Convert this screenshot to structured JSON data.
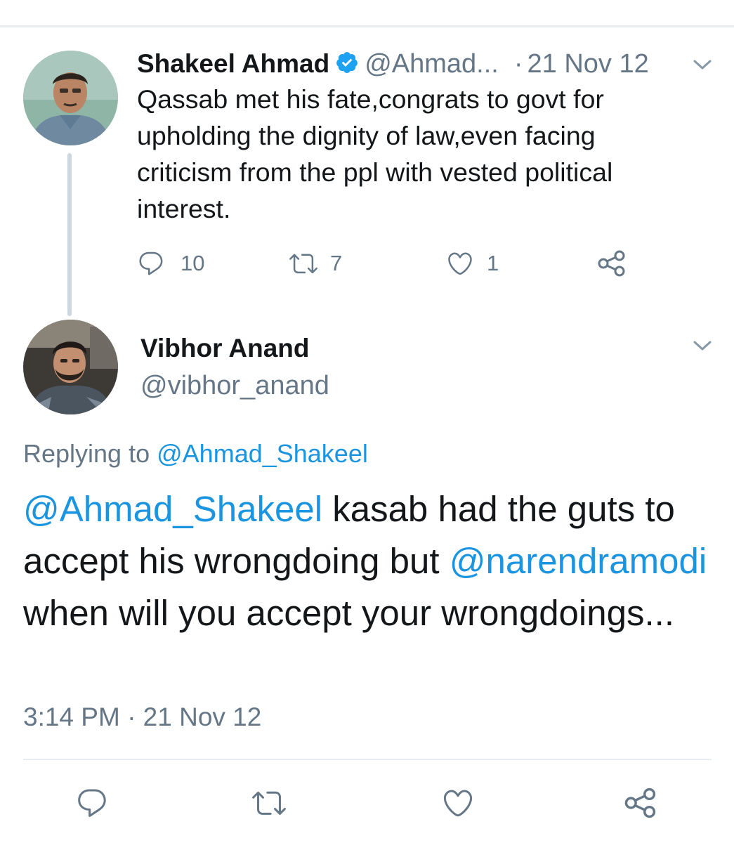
{
  "parent_tweet": {
    "author_name": "Shakeel Ahmad",
    "verified_icon": "verified-badge-icon",
    "handle": "@Ahmad...",
    "separator": "·",
    "date": "21 Nov 12",
    "text": "Qassab met his fate,congrats to govt for upholding the dignity of law,even facing criticism from the ppl with vested political interest.",
    "actions": {
      "reply_count": "10",
      "retweet_count": "7",
      "like_count": "1"
    }
  },
  "reply_tweet": {
    "author_name": "Vibhor Anand",
    "handle": "@vibhor_anand",
    "replying_prefix": "Replying to",
    "replying_to": "@Ahmad_Shakeel",
    "text_parts": {
      "mention1": "@Ahmad_Shakeel",
      "text1": " kasab had the guts to accept his wrongdoing but ",
      "mention2": "@narendramodi",
      "text2": " when will you accept your wrongdoings..."
    },
    "timestamp": "3:14 PM · 21 Nov 12"
  },
  "colors": {
    "link": "#1b95e0",
    "muted": "#657786",
    "text": "#14171a",
    "verified": "#1da1f2",
    "divider": "#e6ecf0"
  },
  "icons": {
    "reply": "reply-icon",
    "retweet": "retweet-icon",
    "like": "heart-icon",
    "share": "share-icon",
    "more": "chevron-down-icon"
  }
}
